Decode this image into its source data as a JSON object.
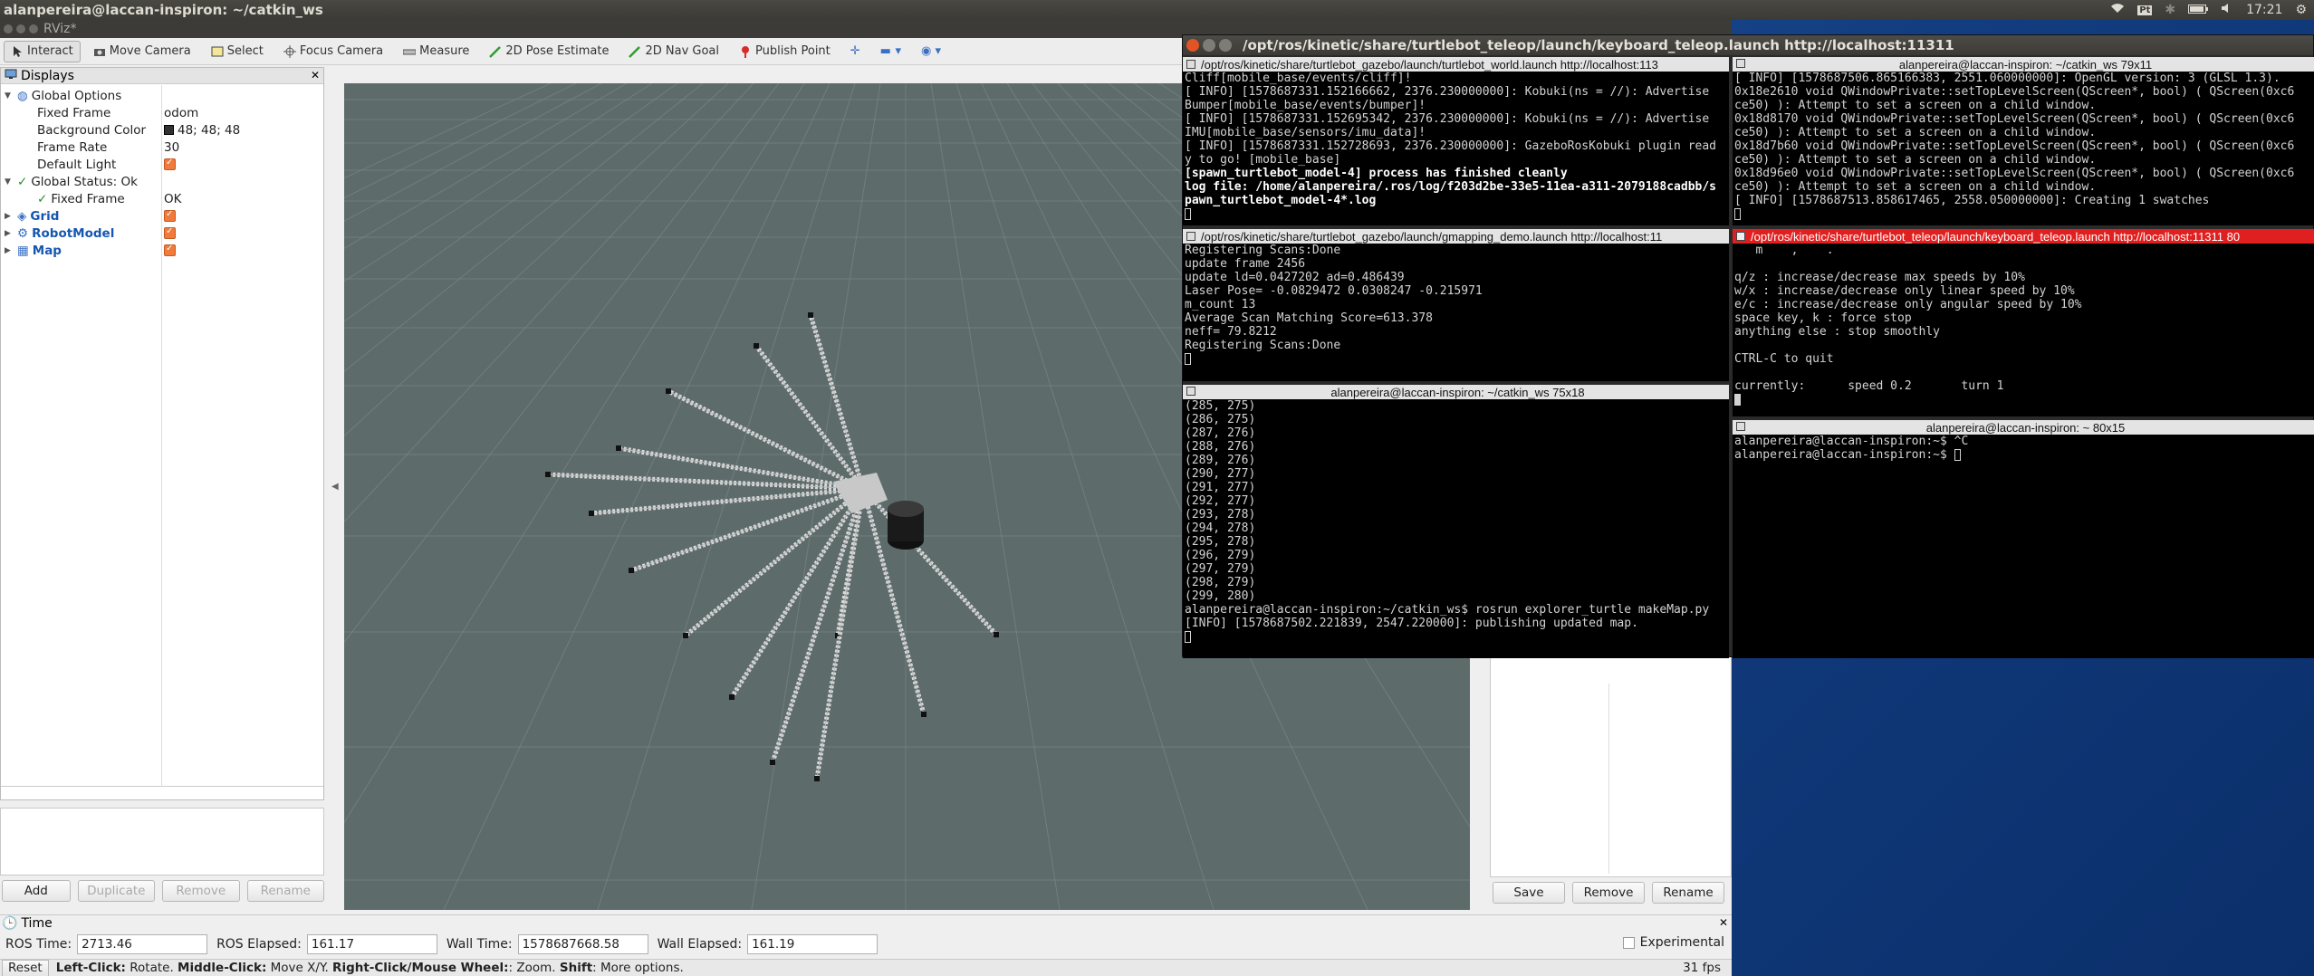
{
  "topbar": {
    "title": "alanpereira@laccan-inspiron: ~/catkin_ws",
    "time": "17:21"
  },
  "rviz": {
    "window_title": "RViz*",
    "tools": [
      "Interact",
      "Move Camera",
      "Select",
      "Focus Camera",
      "Measure",
      "2D Pose Estimate",
      "2D Nav Goal",
      "Publish Point"
    ],
    "displays": {
      "title": "Displays",
      "global_options": "Global Options",
      "fixed_frame_label": "Fixed Frame",
      "fixed_frame_value": "odom",
      "bg_color_label": "Background Color",
      "bg_color_value": "48; 48; 48",
      "frame_rate_label": "Frame Rate",
      "frame_rate_value": "30",
      "default_light_label": "Default Light",
      "global_status": "Global Status: Ok",
      "fixed_frame_status_label": "Fixed Frame",
      "fixed_frame_status_value": "OK",
      "grid": "Grid",
      "robot_model": "RobotModel",
      "map": "Map",
      "add": "Add",
      "duplicate": "Duplicate",
      "remove": "Remove",
      "rename": "Rename"
    },
    "views": {
      "save": "Save",
      "remove": "Remove",
      "rename": "Rename"
    },
    "time": {
      "title": "Time",
      "ros_time_label": "ROS Time:",
      "ros_time": "2713.46",
      "ros_elapsed_label": "ROS Elapsed:",
      "ros_elapsed": "161.17",
      "wall_time_label": "Wall Time:",
      "wall_time": "1578687668.58",
      "wall_elapsed_label": "Wall Elapsed:",
      "wall_elapsed": "161.19",
      "experimental": "Experimental"
    },
    "status": {
      "reset": "Reset",
      "hint_left": "Left-Click:",
      "hint_left_t": " Rotate. ",
      "hint_mid": "Middle-Click:",
      "hint_mid_t": " Move X/Y. ",
      "hint_right": "Right-Click/Mouse Wheel:",
      "hint_right_t": ": Zoom. ",
      "hint_shift": "Shift",
      "hint_shift_t": ": More options.",
      "fps": "31 fps"
    },
    "colors": {
      "viewport": "#5d6c6b",
      "accent": "#f07b3c"
    }
  },
  "terminal": {
    "title": "/opt/ros/kinetic/share/turtlebot_teleop/launch/keyboard_teleop.launch http://localhost:11311",
    "p1": {
      "title": "/opt/ros/kinetic/share/turtlebot_gazebo/launch/turtlebot_world.launch http://localhost:113",
      "lines": [
        "Cliff[mobile_base/events/cliff]!",
        "[ INFO] [1578687331.152166662, 2376.230000000]: Kobuki(ns = //): Advertise",
        "Bumper[mobile_base/events/bumper]!",
        "[ INFO] [1578687331.152695342, 2376.230000000]: Kobuki(ns = //): Advertise",
        "IMU[mobile_base/sensors/imu_data]!",
        "[ INFO] [1578687331.152728693, 2376.230000000]: GazeboRosKobuki plugin read",
        "y to go! [mobile_base]"
      ],
      "bold": [
        "[spawn_turtlebot_model-4] process has finished cleanly",
        "log file: /home/alanpereira/.ros/log/f203d2be-33e5-11ea-a311-2079188cadbb/s",
        "pawn_turtlebot_model-4*.log"
      ]
    },
    "p2": {
      "title": "alanpereira@laccan-inspiron: ~/catkin_ws 79x11",
      "lines": [
        "[ INFO] [1578687506.865166383, 2551.060000000]: OpenGL version: 3 (GLSL 1.3).",
        "0x18e2610 void QWindowPrivate::setTopLevelScreen(QScreen*, bool) ( QScreen(0xc6",
        "ce50) ): Attempt to set a screen on a child window.",
        "0x18d8170 void QWindowPrivate::setTopLevelScreen(QScreen*, bool) ( QScreen(0xc6",
        "ce50) ): Attempt to set a screen on a child window.",
        "0x18d7b60 void QWindowPrivate::setTopLevelScreen(QScreen*, bool) ( QScreen(0xc6",
        "ce50) ): Attempt to set a screen on a child window.",
        "0x18d96e0 void QWindowPrivate::setTopLevelScreen(QScreen*, bool) ( QScreen(0xc6",
        "ce50) ): Attempt to set a screen on a child window.",
        "[ INFO] [1578687513.858617465, 2558.050000000]: Creating 1 swatches"
      ]
    },
    "p3": {
      "title": "/opt/ros/kinetic/share/turtlebot_gazebo/launch/gmapping_demo.launch http://localhost:11",
      "lines": [
        "Registering Scans:Done",
        "update frame 2456",
        "update ld=0.0427202 ad=0.486439",
        "Laser Pose= -0.0829472 0.0308247 -0.215971",
        "m_count 13",
        "Average Scan Matching Score=613.378",
        "neff= 79.8212",
        "Registering Scans:Done"
      ]
    },
    "p4": {
      "title": "/opt/ros/kinetic/share/turtlebot_teleop/launch/keyboard_teleop.launch http://localhost:11311 80",
      "lines": [
        "   m    ,    .",
        "",
        "q/z : increase/decrease max speeds by 10%",
        "w/x : increase/decrease only linear speed by 10%",
        "e/c : increase/decrease only angular speed by 10%",
        "space key, k : force stop",
        "anything else : stop smoothly",
        "",
        "CTRL-C to quit",
        "",
        "currently:      speed 0.2       turn 1"
      ]
    },
    "p5": {
      "title": "alanpereira@laccan-inspiron: ~/catkin_ws 75x18",
      "lines": [
        "(285, 275)",
        "(286, 275)",
        "(287, 276)",
        "(288, 276)",
        "(289, 276)",
        "(290, 277)",
        "(291, 277)",
        "(292, 277)",
        "(293, 278)",
        "(294, 278)",
        "(295, 278)",
        "(296, 279)",
        "(297, 279)",
        "(298, 279)",
        "(299, 280)",
        "alanpereira@laccan-inspiron:~/catkin_ws$ rosrun explorer_turtle makeMap.py",
        "[INFO] [1578687502.221839, 2547.220000]: publishing updated map."
      ]
    },
    "p6": {
      "title": "alanpereira@laccan-inspiron: ~ 80x15",
      "lines": [
        "alanpereira@laccan-inspiron:~$ ^C",
        "alanpereira@laccan-inspiron:~$ "
      ]
    }
  }
}
